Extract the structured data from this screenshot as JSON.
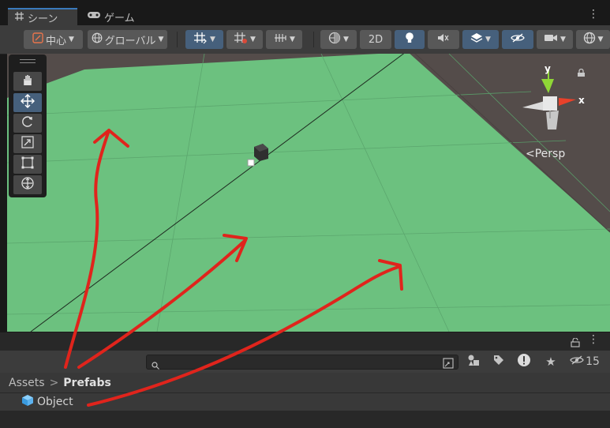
{
  "tabs": [
    {
      "label": "シーン",
      "icon": "grid-icon"
    },
    {
      "label": "ゲーム",
      "icon": "gamepad-icon"
    }
  ],
  "toolbar": {
    "pivot_label": "中心",
    "space_label": "グローバル",
    "mode_2d_label": "2D"
  },
  "scene": {
    "persp_label": "Persp",
    "gizmo_x_label": "x",
    "gizmo_y_label": "y"
  },
  "project": {
    "hidden_count": "15",
    "breadcrumb": {
      "root": "Assets",
      "separator": ">",
      "current": "Prefabs"
    },
    "items": [
      {
        "name": "Object",
        "icon": "prefab-cube-icon"
      }
    ]
  },
  "colors": {
    "ground": "#6cc17f",
    "background": "#544c4a",
    "active_button": "#46607c",
    "annotation": "#e0241c"
  }
}
